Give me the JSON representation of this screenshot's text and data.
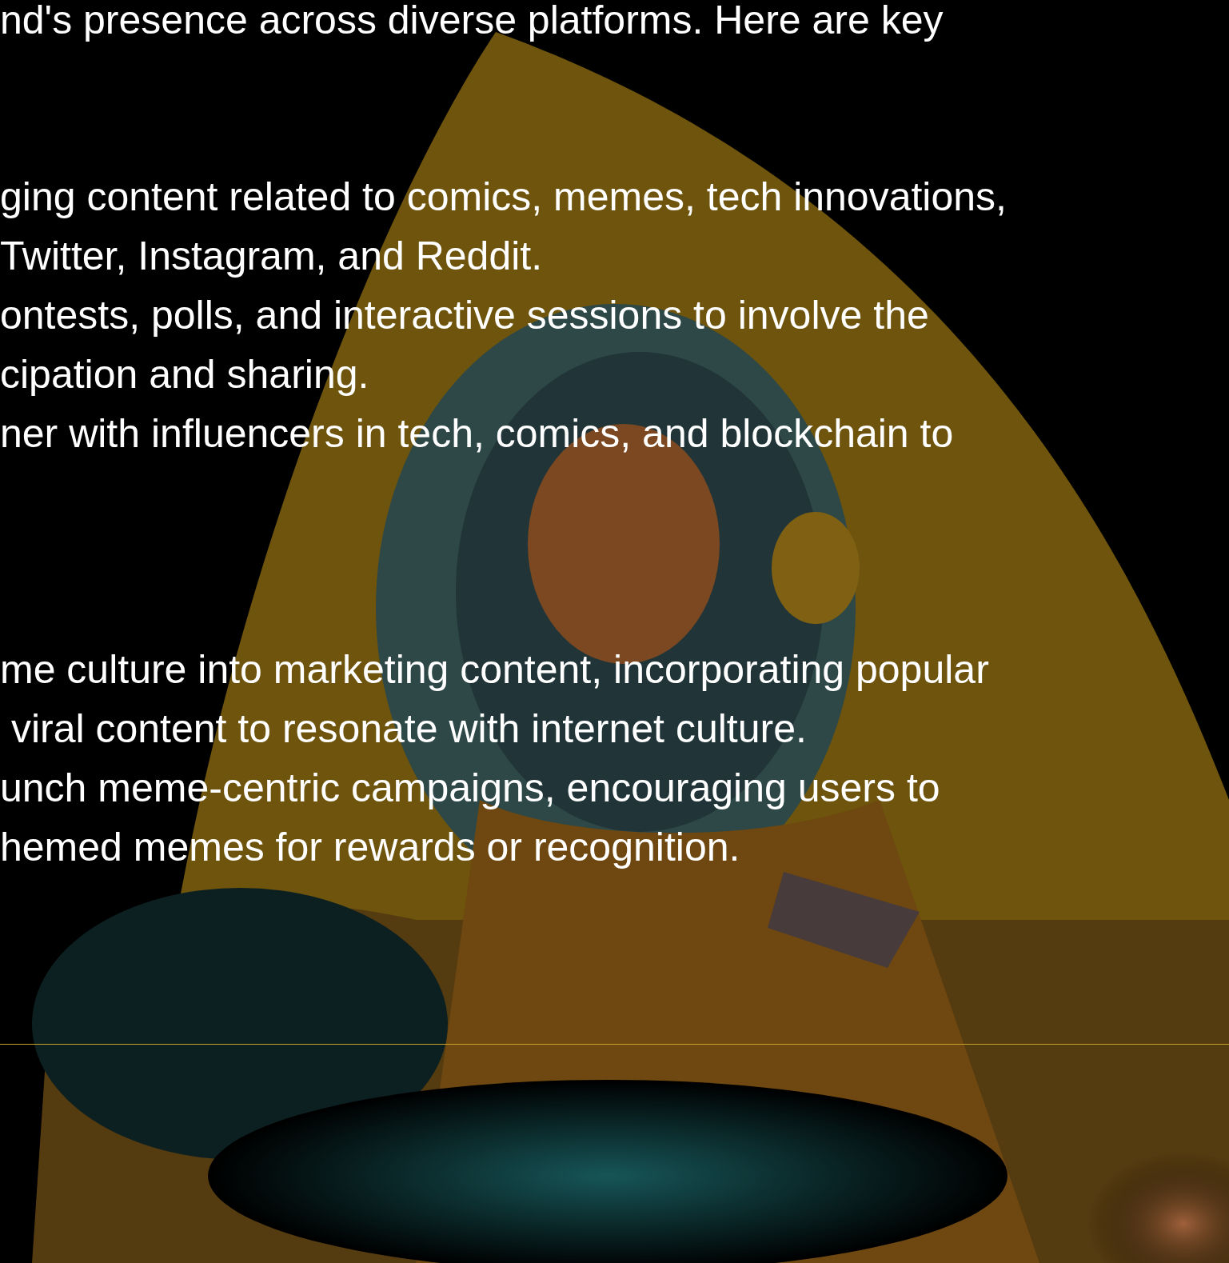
{
  "sections": [
    {
      "lines": [
        "nd's presence across diverse platforms. Here are key"
      ]
    },
    {
      "lines": [
        "ging content related to comics, memes, tech innovations,",
        "Twitter, Instagram, and Reddit.",
        "ontests, polls, and interactive sessions to involve the",
        "cipation and sharing.",
        "ner with influencers in tech, comics, and blockchain to"
      ]
    },
    {
      "lines": [
        "me culture into marketing content, incorporating popular",
        " viral content to resonate with internet culture.",
        "unch meme-centric campaigns, encouraging users to",
        "hemed memes for rewards or recognition."
      ]
    }
  ]
}
